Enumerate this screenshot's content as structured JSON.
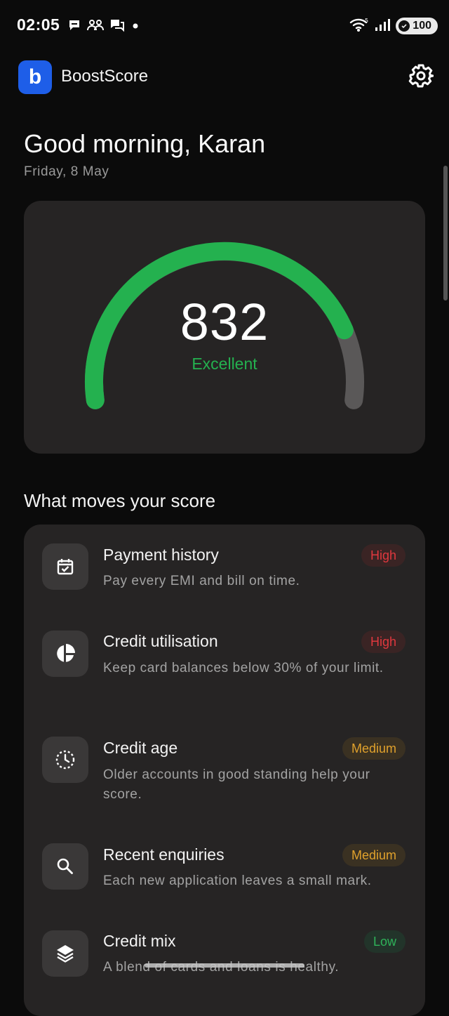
{
  "status_bar": {
    "time": "02:05",
    "battery": "100",
    "icons": [
      "chat-icon",
      "group-icon",
      "messages-icon",
      "dot-icon",
      "wifi-icon",
      "signal-icon",
      "battery-icon"
    ]
  },
  "header": {
    "logo_letter": "b",
    "app_name": "BoostScore"
  },
  "greeting": {
    "title": "Good morning, Karan",
    "date": "Friday, 8 May"
  },
  "score": {
    "value": "832",
    "rating": "Excellent",
    "fraction": 0.84,
    "accent": "#24b14f",
    "track": "#5a5858"
  },
  "section_title": "What moves your score",
  "factors": [
    {
      "title": "Payment history",
      "desc": "Pay every EMI and bill on time.",
      "impact": "High",
      "level": "high",
      "icon": "calendar-check-icon"
    },
    {
      "title": "Credit utilisation",
      "desc": "Keep card balances below 30% of your limit.",
      "impact": "High",
      "level": "high",
      "icon": "pie-chart-icon"
    },
    {
      "title": "Credit age",
      "desc": "Older accounts in good standing help your score.",
      "impact": "Medium",
      "level": "medium",
      "icon": "clock-icon"
    },
    {
      "title": "Recent enquiries",
      "desc": "Each new application leaves a small mark.",
      "impact": "Medium",
      "level": "medium",
      "icon": "search-icon"
    },
    {
      "title": "Credit mix",
      "desc": "A blend of cards and loans is healthy.",
      "impact": "Low",
      "level": "low",
      "icon": "layers-icon"
    }
  ]
}
